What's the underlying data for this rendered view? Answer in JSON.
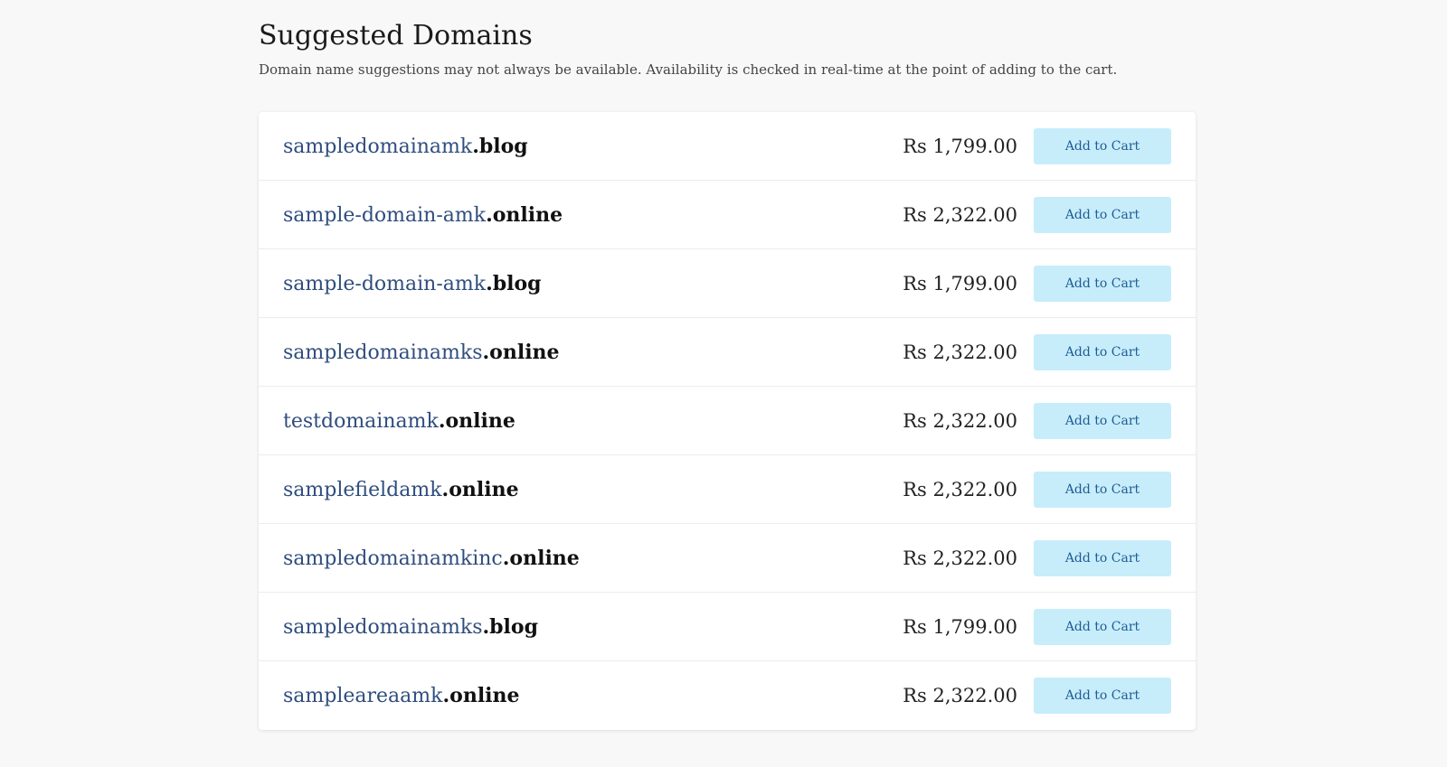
{
  "header": {
    "title": "Suggested Domains",
    "subtitle": "Domain name suggestions may not always be available. Availability is checked in real-time at the point of adding to the cart."
  },
  "suggestions": [
    {
      "sld": "sampledomainamk",
      "tld": ".blog",
      "price": "Rs 1,799.00",
      "button": "Add to Cart"
    },
    {
      "sld": "sample-domain-amk",
      "tld": ".online",
      "price": "Rs 2,322.00",
      "button": "Add to Cart"
    },
    {
      "sld": "sample-domain-amk",
      "tld": ".blog",
      "price": "Rs 1,799.00",
      "button": "Add to Cart"
    },
    {
      "sld": "sampledomainamks",
      "tld": ".online",
      "price": "Rs 2,322.00",
      "button": "Add to Cart"
    },
    {
      "sld": "testdomainamk",
      "tld": ".online",
      "price": "Rs 2,322.00",
      "button": "Add to Cart"
    },
    {
      "sld": "samplefieldamk",
      "tld": ".online",
      "price": "Rs 2,322.00",
      "button": "Add to Cart"
    },
    {
      "sld": "sampledomainamkinc",
      "tld": ".online",
      "price": "Rs 2,322.00",
      "button": "Add to Cart"
    },
    {
      "sld": "sampledomainamks",
      "tld": ".blog",
      "price": "Rs 1,799.00",
      "button": "Add to Cart"
    },
    {
      "sld": "sampleareaamk",
      "tld": ".online",
      "price": "Rs 2,322.00",
      "button": "Add to Cart"
    }
  ],
  "colors": {
    "sld": "#2f4d7e",
    "button_bg": "#c7edfb",
    "button_text": "#1f5c94"
  }
}
